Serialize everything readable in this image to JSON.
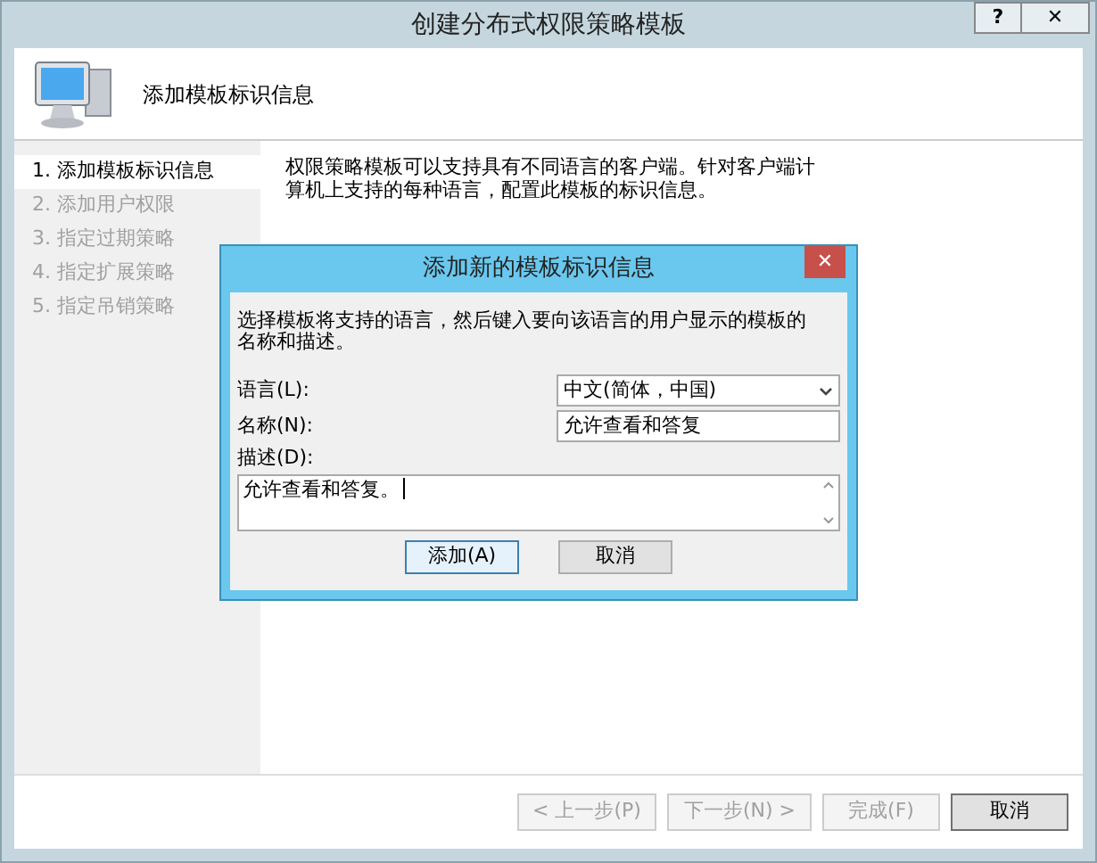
{
  "window": {
    "title": "创建分布式权限策略模板",
    "help": "?",
    "close": "✕"
  },
  "header": {
    "title": "添加模板标识信息"
  },
  "steps": [
    {
      "label": "1. 添加模板标识信息",
      "selected": true,
      "disabled": false
    },
    {
      "label": "2. 添加用户权限",
      "selected": false,
      "disabled": true
    },
    {
      "label": "3. 指定过期策略",
      "selected": false,
      "disabled": true
    },
    {
      "label": "4. 指定扩展策略",
      "selected": false,
      "disabled": true
    },
    {
      "label": "5. 指定吊销策略",
      "selected": false,
      "disabled": true
    }
  ],
  "content": {
    "description": "权限策略模板可以支持具有不同语言的客户端。针对客户端计算机上支持的每种语言，配置此模板的标识信息。"
  },
  "footer_buttons": [
    {
      "label": "< 上一步(P)",
      "disabled": true
    },
    {
      "label": "下一步(N) >",
      "disabled": true
    },
    {
      "label": "完成(F)",
      "disabled": true
    },
    {
      "label": "取消",
      "disabled": false
    }
  ],
  "dialog": {
    "title": "添加新的模板标识信息",
    "close": "✕",
    "instructions": "选择模板将支持的语言，然后键入要向该语言的用户显示的模板的名称和描述。",
    "language": {
      "label": "语言(L):",
      "value": "中文(简体，中国)"
    },
    "name": {
      "label": "名称(N):",
      "value": "允许查看和答复"
    },
    "description": {
      "label": "描述(D):",
      "value": "允许查看和答复。"
    },
    "buttons": [
      {
        "label": "添加(A)",
        "selected": true
      },
      {
        "label": "取消",
        "selected": false
      }
    ]
  }
}
